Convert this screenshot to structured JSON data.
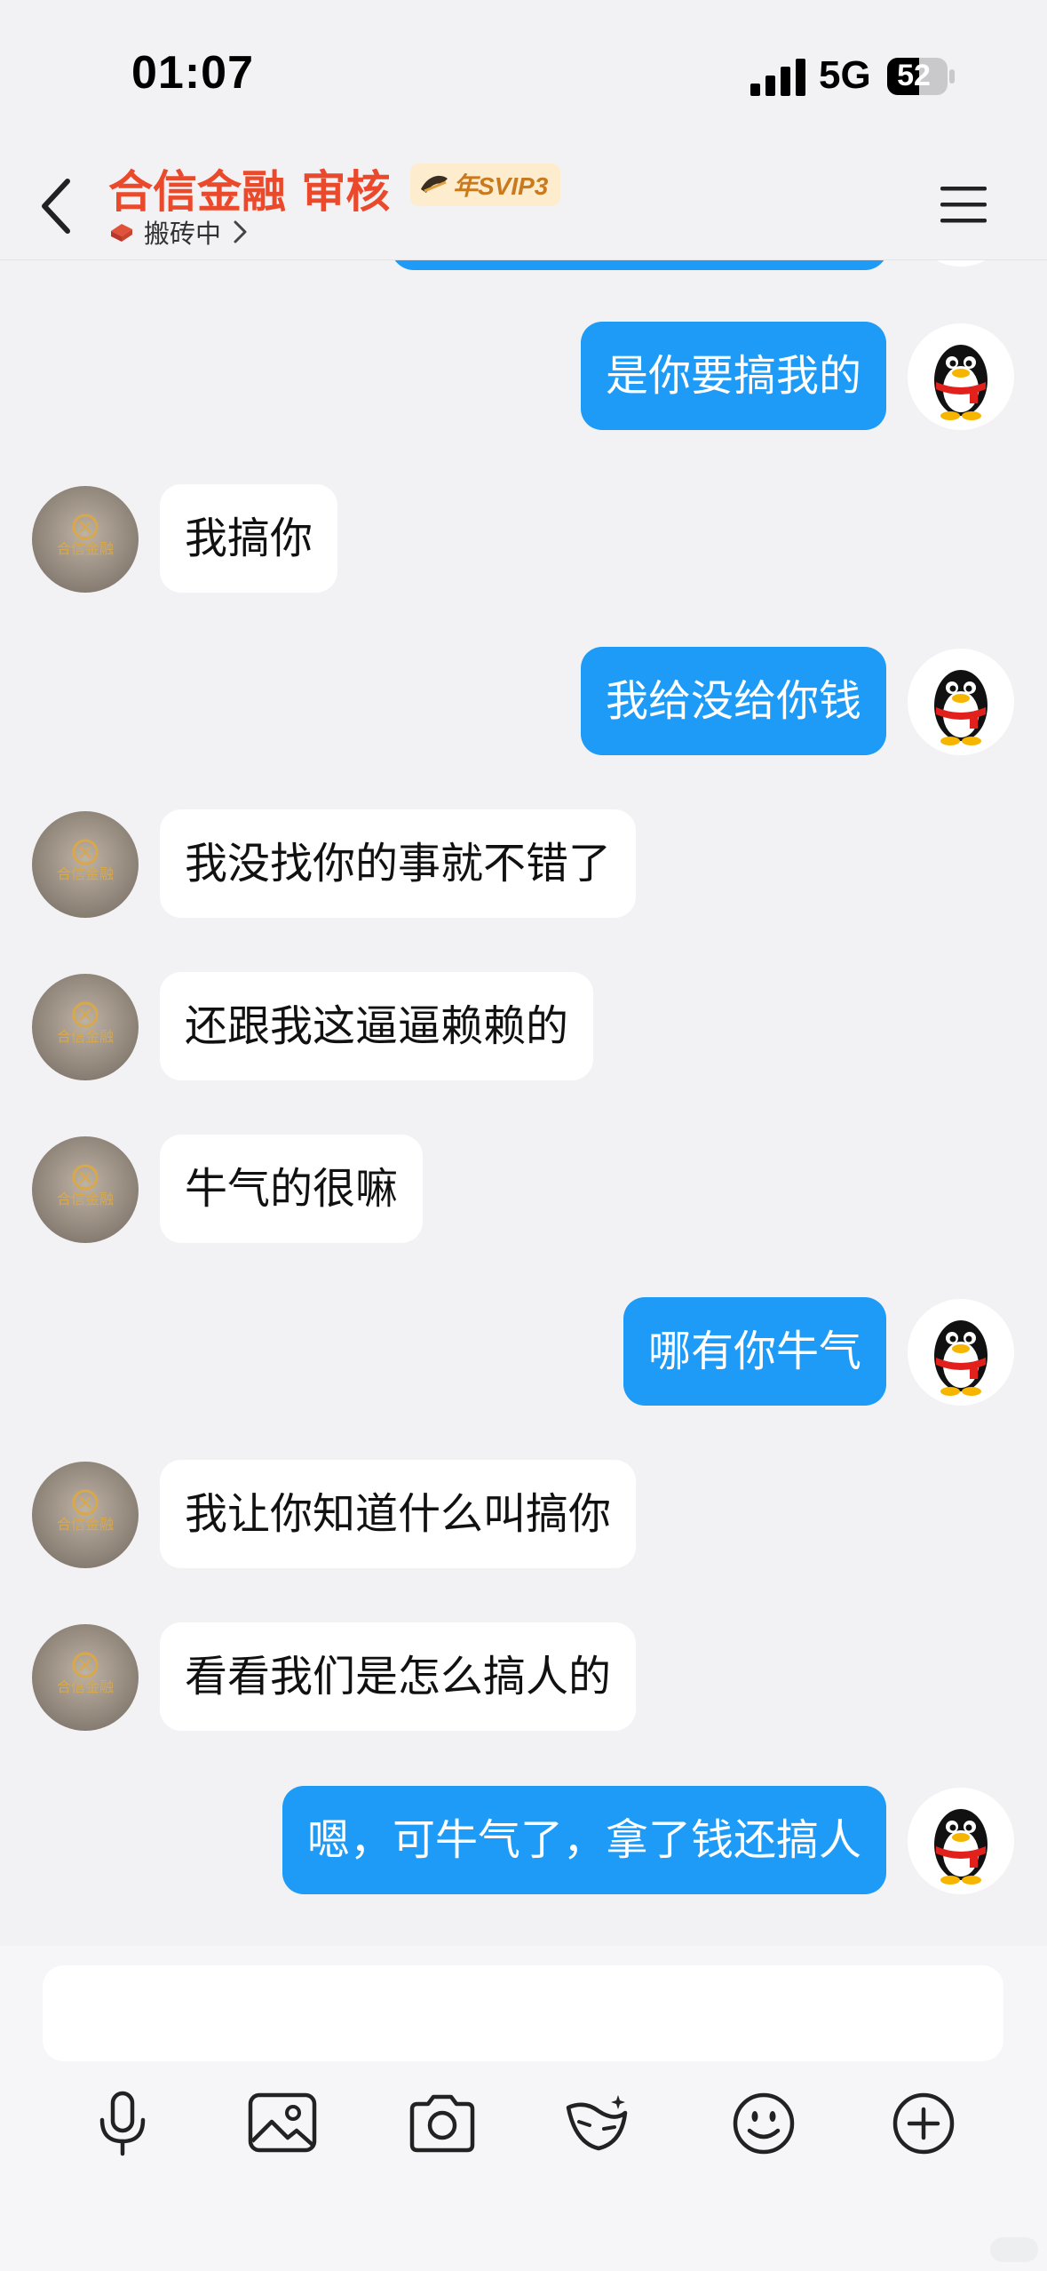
{
  "status_bar": {
    "time": "01:07",
    "network": "5G",
    "battery": "52"
  },
  "header": {
    "title": "合信金融 审核",
    "badge": "年SVIP3",
    "status": "搬砖中",
    "colors": {
      "title": "#ea4a2b",
      "badge_bg": "#fdeccd",
      "badge_text": "#c97a1d"
    }
  },
  "messages": [
    {
      "side": "out",
      "text": "是你要搞我的"
    },
    {
      "side": "in",
      "text": "我搞你"
    },
    {
      "side": "out",
      "text": "我给没给你钱"
    },
    {
      "side": "in",
      "text": "我没找你的事就不错了"
    },
    {
      "side": "in",
      "text": "还跟我这逼逼赖赖的"
    },
    {
      "side": "in",
      "text": "牛气的很嘛"
    },
    {
      "side": "out",
      "text": "哪有你牛气"
    },
    {
      "side": "in",
      "text": "我让你知道什么叫搞你"
    },
    {
      "side": "in",
      "text": "看看我们是怎么搞人的"
    },
    {
      "side": "out",
      "text": "嗯，可牛气了，拿了钱还搞人"
    }
  ],
  "contact_avatar_text": "合信金融",
  "input": {
    "value": "",
    "placeholder": ""
  },
  "toolbar": [
    {
      "name": "microphone-icon"
    },
    {
      "name": "image-icon"
    },
    {
      "name": "camera-icon"
    },
    {
      "name": "red-packet-icon"
    },
    {
      "name": "emoji-icon"
    },
    {
      "name": "plus-icon"
    }
  ],
  "colors": {
    "out_bubble": "#1d9bf6",
    "in_bubble": "#ffffff",
    "background": "#f2f2f4"
  }
}
